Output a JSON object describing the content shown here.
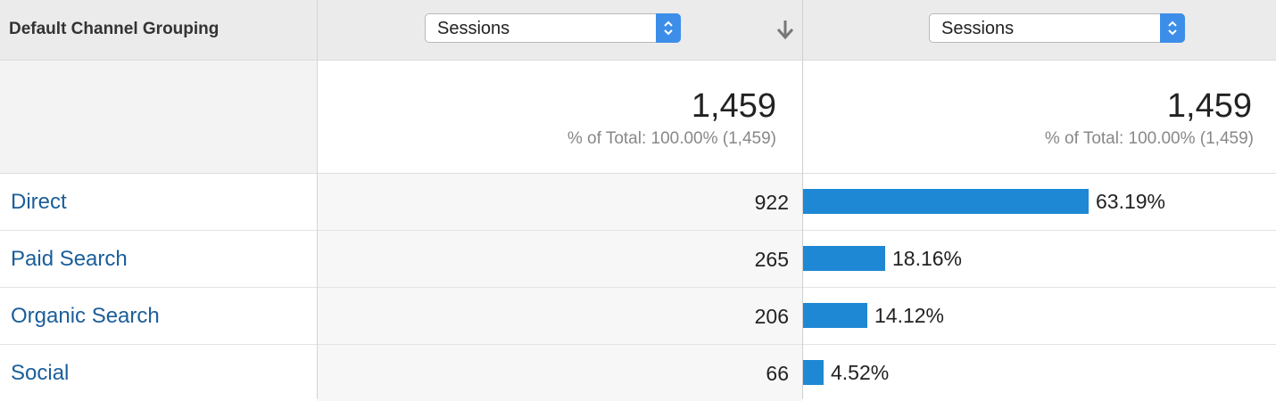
{
  "header": {
    "dimension_label": "Default Channel Grouping",
    "metric1_select": "Sessions",
    "metric2_select": "Sessions"
  },
  "totals": {
    "metric1_value": "1,459",
    "metric1_sub": "% of Total: 100.00% (1,459)",
    "metric2_value": "1,459",
    "metric2_sub": "% of Total: 100.00% (1,459)"
  },
  "rows": [
    {
      "name": "Direct",
      "sessions": "922",
      "percent_label": "63.19%",
      "percent": 63.19
    },
    {
      "name": "Paid Search",
      "sessions": "265",
      "percent_label": "18.16%",
      "percent": 18.16
    },
    {
      "name": "Organic Search",
      "sessions": "206",
      "percent_label": "14.12%",
      "percent": 14.12
    },
    {
      "name": "Social",
      "sessions": "66",
      "percent_label": "4.52%",
      "percent": 4.52
    }
  ],
  "colors": {
    "bar": "#1e88d4",
    "link": "#1a5e9a",
    "select_button": "#3d8ee8"
  }
}
